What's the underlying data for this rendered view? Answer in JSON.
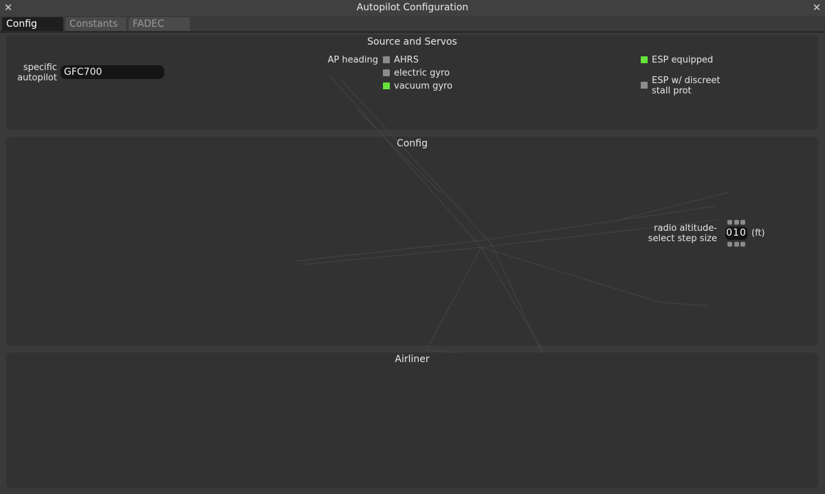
{
  "window": {
    "title": "Autopilot Configuration"
  },
  "tabs": [
    {
      "label": "Config",
      "active": true
    },
    {
      "label": "Constants",
      "active": false
    },
    {
      "label": "FADEC",
      "active": false
    }
  ],
  "source_servos": {
    "title": "Source and Servos",
    "specific_autopilot_label_1": "specific",
    "specific_autopilot_label_2": "autopilot",
    "specific_autopilot_value": "GFC700",
    "ap_heading_label": "AP heading",
    "ap_heading_options": [
      {
        "label": "AHRS",
        "checked": false
      },
      {
        "label": "electric gyro",
        "checked": false
      },
      {
        "label": "vacuum gyro",
        "checked": true
      }
    ],
    "esp_equipped": {
      "label": "ESP equipped",
      "checked": true
    },
    "esp_stall": {
      "label_1": "ESP w/ discreet",
      "label_2": "stall prot",
      "checked": false
    }
  },
  "config": {
    "title": "Config",
    "radio_alt_label_1": "radio altitude-",
    "radio_alt_label_2": "select step size",
    "radio_alt_value": "010",
    "radio_alt_unit": "(ft)"
  },
  "airliner": {
    "title": "Airliner"
  },
  "colors": {
    "checked": "#66e23a",
    "unchecked": "#8c8c8c",
    "panel": "#323232",
    "background": "#3a3a3a"
  }
}
